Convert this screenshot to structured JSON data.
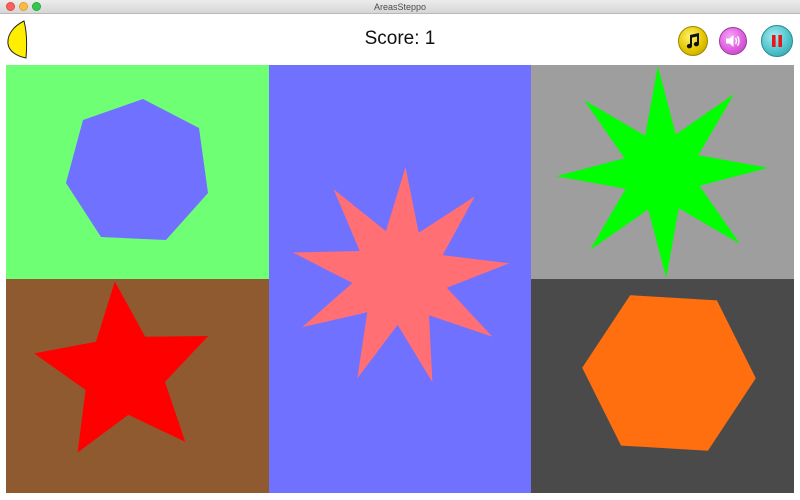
{
  "window": {
    "title": "AreasSteppo"
  },
  "header": {
    "score_text": "Score: 1",
    "buttons": {
      "music": {
        "icon": "music-note-icon",
        "color": "#e3c600"
      },
      "sound": {
        "icon": "speaker-icon",
        "color": "#de5ee0"
      },
      "pause": {
        "icon": "pause-icon",
        "color": "#4fc3cc"
      }
    },
    "leaf": {
      "icon": "leaf-icon",
      "color": "#ffee00"
    }
  },
  "board": {
    "cells": [
      {
        "id": "top-left",
        "background": "#6fff74",
        "shape": "heptagon",
        "shape_color": "#7171ff"
      },
      {
        "id": "center",
        "background": "#7171ff",
        "shape": "9-point-star",
        "shape_color": "#ff6f74"
      },
      {
        "id": "top-right",
        "background": "#9e9e9e",
        "shape": "8-point-star",
        "shape_color": "#00ff00"
      },
      {
        "id": "bottom-left",
        "background": "#8f5a30",
        "shape": "5-point-star",
        "shape_color": "#ff0000"
      },
      {
        "id": "bottom-right",
        "background": "#4a4a4a",
        "shape": "hexagon",
        "shape_color": "#ff6f0f"
      }
    ]
  }
}
